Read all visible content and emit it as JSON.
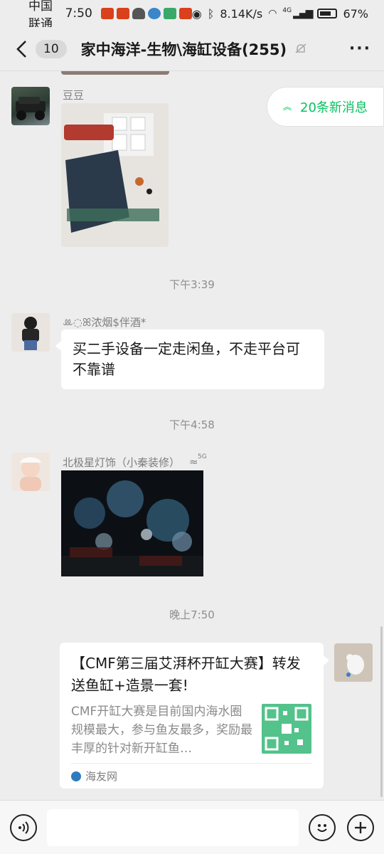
{
  "status_bar": {
    "carrier": "中国联通",
    "time": "7:50",
    "net_speed": "8.14K/s",
    "signal_label": "4G",
    "battery": "67%"
  },
  "header": {
    "back_count": "10",
    "title": "家中海洋-生物\\海缸设备(255)"
  },
  "new_messages": {
    "label": "20条新消息"
  },
  "messages": [
    {
      "sender": "豆豆",
      "type": "image"
    },
    {
      "time": "下午3:39"
    },
    {
      "sender": "ꔛ◌ꕤ浓烟$伴酒*",
      "type": "text",
      "text": "买二手设备一定走闲鱼，不走平台可不靠谱"
    },
    {
      "time": "下午4:58"
    },
    {
      "sender": "北极星灯饰（小秦装修）",
      "sender_suffix": "5G",
      "type": "image"
    },
    {
      "time": "晚上7:50"
    },
    {
      "type": "card",
      "card": {
        "title": "【CMF第三届艾湃杯开缸大赛】转发送鱼缸+造景一套!",
        "description": "CMF开缸大赛是目前国内海水圈规模最大，参与鱼友最多，奖励最丰厚的针对新开缸鱼…",
        "source": "海友网"
      }
    }
  ],
  "colors": {
    "accent": "#07c160",
    "background": "#ededed",
    "bubble": "#ffffff"
  }
}
